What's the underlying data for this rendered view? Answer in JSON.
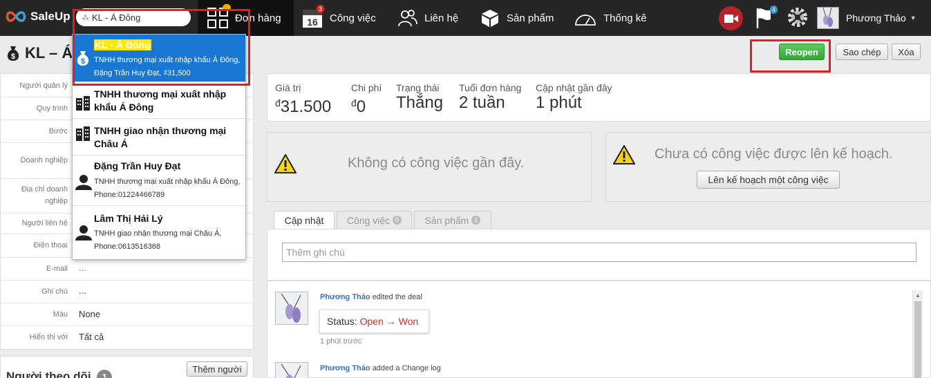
{
  "app": {
    "name": "SaleUp"
  },
  "search": {
    "value": "KL - Á Đông",
    "spinner": "⁂"
  },
  "nav": [
    {
      "label": "Đơn hàng",
      "badge": ""
    },
    {
      "label": "Công việc",
      "badge": "3",
      "cal_month": "",
      "cal_day": "16"
    },
    {
      "label": "Liên hệ"
    },
    {
      "label": "Sản phẩm"
    },
    {
      "label": "Thống kê"
    }
  ],
  "flag_badge": "4",
  "user": {
    "name": "Phương Thảo",
    "caret": "▼"
  },
  "page": {
    "title": "KL – Á"
  },
  "actions": {
    "reopen": "Reopen",
    "copy": "Sao chép",
    "delete": "Xóa"
  },
  "fields": [
    {
      "label": "Người quản lý",
      "value": ""
    },
    {
      "label": "Quy trình",
      "value": ""
    },
    {
      "label": "Bước",
      "value": ""
    },
    {
      "label": "Doanh nghiệp",
      "value": ""
    },
    {
      "label": "Địa chỉ doanh nghiệp",
      "value": ""
    },
    {
      "label": "Người liên hệ",
      "value": ""
    },
    {
      "label": "Điện thoại",
      "value": ""
    },
    {
      "label": "E-mail",
      "value": "..."
    },
    {
      "label": "Ghi chú",
      "value": "..."
    },
    {
      "label": "Màu",
      "value": "None"
    },
    {
      "label": "Hiển thị với",
      "value": "Tất cả"
    }
  ],
  "followers": {
    "title": "Người theo dõi",
    "count": "1",
    "add_label": "Thêm người"
  },
  "dropdown": [
    {
      "title_prefix": "",
      "title_hl": "KL - Á Đông",
      "sub": "TNHH thương mại xuất nhập khẩu Á Đông, Đặng Trần Huy Đạt, ₫31,500",
      "icon": "money-bag-icon"
    },
    {
      "title": "TNHH thương mại xuất nhập khẩu Á Đông",
      "icon": "building-icon"
    },
    {
      "title": "TNHH giao nhận thương mại Châu Á",
      "icon": "building-icon"
    },
    {
      "title": "Đặng Trần Huy Đạt",
      "sub": "TNHH thương mại xuất nhập khẩu Á Đông, Phone:01224466789",
      "icon": "person-icon"
    },
    {
      "title": "Lâm Thị Hải Lý",
      "sub": "TNHH giao nhận thương mại Châu Á, Phone:0613516368",
      "icon": "person-icon"
    }
  ],
  "stats": [
    {
      "label": "Giá trị",
      "currency": "đ",
      "value": "31.500"
    },
    {
      "label": "Chi phí",
      "currency": "đ",
      "value": "0"
    },
    {
      "label": "Trạng thái",
      "currency": "",
      "value": "Thắng"
    },
    {
      "label": "Tuổi đơn hàng",
      "currency": "",
      "value": "2 tuần"
    },
    {
      "label": "Cập nhật gần đây",
      "currency": "",
      "value": "1 phút"
    }
  ],
  "tasks": {
    "recent": "Không có công việc gần đây.",
    "planned": "Chưa có công việc được lên kế hoạch.",
    "plan_button": "Lên kế hoạch một công việc"
  },
  "tabs": [
    {
      "label": "Cập nhật",
      "count": ""
    },
    {
      "label": "Công việc",
      "count": "0"
    },
    {
      "label": "Sản phẩm",
      "count": "1"
    }
  ],
  "note": {
    "placeholder": "Thêm ghi chú"
  },
  "feed": [
    {
      "who": "Phương Thảo",
      "action": "edited the deal",
      "status_label": "Status:",
      "status_value": "Open → Won",
      "time": "1 phút trước"
    },
    {
      "who": "Phương Thảo",
      "action": "added a Change log"
    }
  ],
  "colors": {
    "topbar": "#262626",
    "selected": "#1777d2",
    "reopen": "#37a537",
    "highlight_box": "#e02020"
  }
}
